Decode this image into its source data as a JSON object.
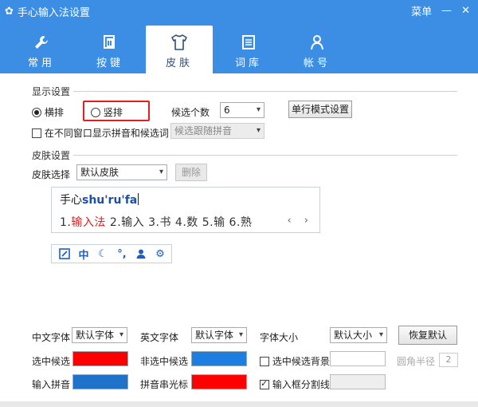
{
  "window": {
    "title": "手心输入法设置",
    "menu_label": "菜单"
  },
  "colors": {
    "header": "#3b8ee3",
    "red": "#ff0000",
    "blue": "#1e7de0",
    "blue2": "#1f72c9"
  },
  "tabs": [
    {
      "label": "常用",
      "icon": "wrench-icon"
    },
    {
      "label": "按键",
      "icon": "key-icon"
    },
    {
      "label": "皮肤",
      "icon": "tshirt-icon",
      "active": true
    },
    {
      "label": "词库",
      "icon": "book-icon"
    },
    {
      "label": "帐号",
      "icon": "user-icon"
    }
  ],
  "display": {
    "section_title": "显示设置",
    "horizontal": "横排",
    "vertical": "竖排",
    "candidate_count_label": "候选个数",
    "candidate_count_value": "6",
    "single_line_button": "单行模式设置",
    "separate_window_label": "在不同窗口显示拼音和候选词",
    "follow_select": "候选跟随拼音"
  },
  "skin": {
    "section_title": "皮肤设置",
    "select_label": "皮肤选择",
    "select_value": "默认皮肤",
    "delete_button": "删除"
  },
  "preview": {
    "input_prefix": "手心",
    "input_pinyin": "shu'ru'fa",
    "cand_1_num": "1.",
    "cand_1_text": "输入法",
    "cand_rest": "2.输入  3.书  4.数  5.输  6.熟",
    "arrows": "‹ ›"
  },
  "toolbar": {
    "zh_label": "中"
  },
  "fonts": {
    "chinese_font_label": "中文字体",
    "chinese_font_value": "默认字体",
    "english_font_label": "英文字体",
    "english_font_value": "默认字体",
    "font_size_label": "字体大小",
    "font_size_value": "默认大小",
    "restore_button": "恢复默认"
  },
  "colors_rows": {
    "selected_cand": "选中候选",
    "unselected_cand": "非选中候选",
    "selected_bg": "选中候选背景",
    "corner_radius": "圆角半径",
    "corner_value": "2",
    "input_pinyin": "输入拼音",
    "pinyin_cursor": "拼音串光标",
    "input_divider": "输入框分割线"
  }
}
